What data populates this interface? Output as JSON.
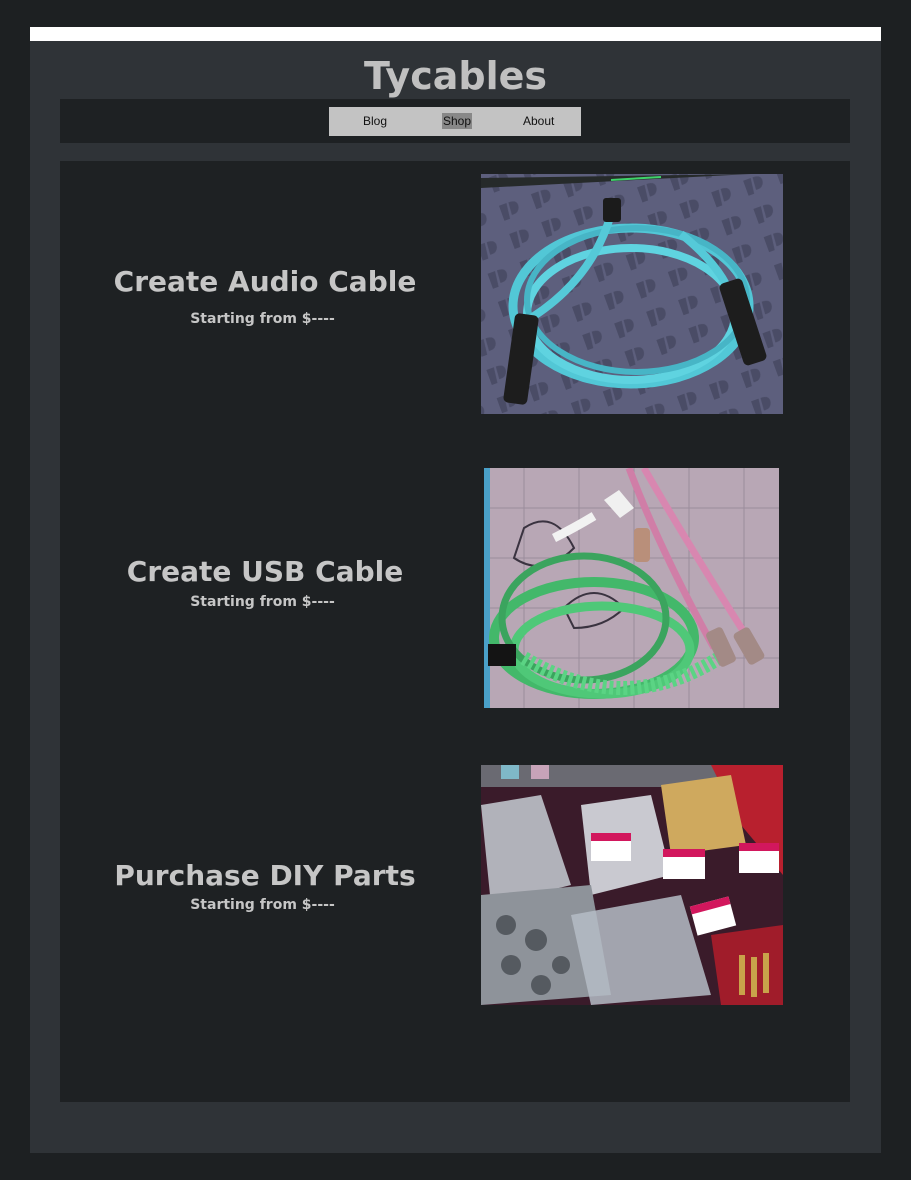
{
  "header": {
    "site_title": "Tycables"
  },
  "nav": {
    "items": [
      {
        "label": "Blog"
      },
      {
        "label": "Shop"
      },
      {
        "label": "About"
      }
    ],
    "active": "Shop"
  },
  "products": [
    {
      "title": "Create Audio Cable",
      "price": "Starting from $----",
      "image": "coiled-turquoise-xlr-audio-cable-photo"
    },
    {
      "title": "Create USB Cable",
      "price": "Starting from $----",
      "image": "coiled-green-usb-cable-and-pink-aviator-cable-photo"
    },
    {
      "title": "Purchase DIY Parts",
      "price": "Starting from $----",
      "image": "bags-of-connector-parts-photo"
    }
  ],
  "colors": {
    "page_background": "#1d2022",
    "frame_background": "#2f3337",
    "panel_background": "#1e2123",
    "text": "#c6c6c6",
    "nav_background": "#c3c3c3",
    "nav_active": "#888888"
  }
}
